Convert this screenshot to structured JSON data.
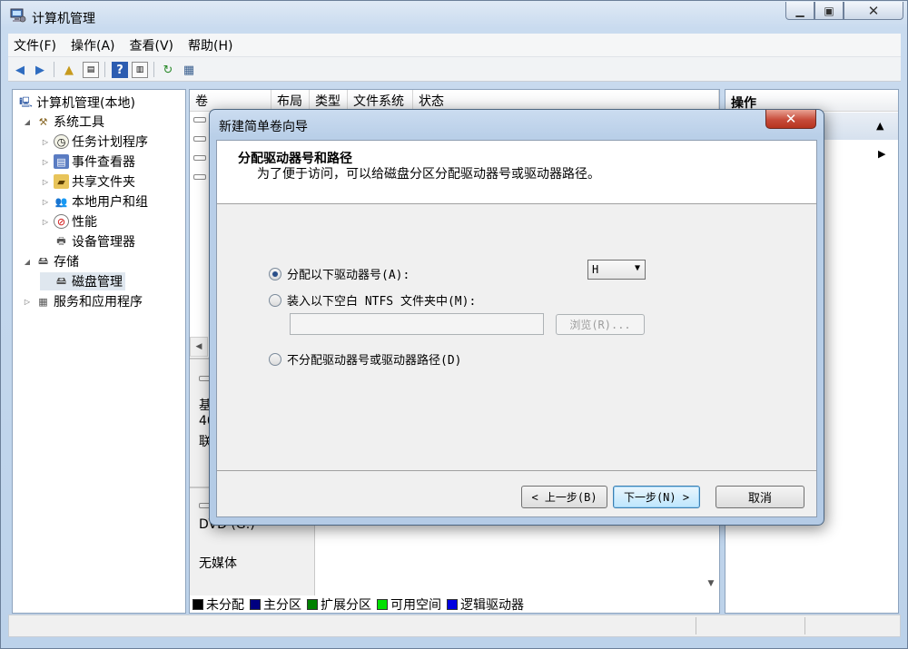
{
  "window": {
    "title": "计算机管理"
  },
  "menu": [
    "文件(F)",
    "操作(A)",
    "查看(V)",
    "帮助(H)"
  ],
  "tree": {
    "root": "计算机管理(本地)",
    "system_tools": "系统工具",
    "task_scheduler": "任务计划程序",
    "event_viewer": "事件查看器",
    "shared_folders": "共享文件夹",
    "local_users": "本地用户和组",
    "performance": "性能",
    "device_manager": "设备管理器",
    "storage": "存储",
    "disk_management": "磁盘管理",
    "services_apps": "服务和应用程序"
  },
  "columns": [
    "卷",
    "布局",
    "类型",
    "文件系统",
    "状态"
  ],
  "disk_panel": {
    "basic_label": "基",
    "size_label": "40",
    "online_label": "联",
    "dvd_label": "DVD (G:)",
    "no_media": "无媒体"
  },
  "actions": {
    "header": "操作"
  },
  "legend": [
    {
      "label": "未分配",
      "color": "#000000"
    },
    {
      "label": "主分区",
      "color": "#000080"
    },
    {
      "label": "扩展分区",
      "color": "#008000"
    },
    {
      "label": "可用空间",
      "color": "#00e000"
    },
    {
      "label": "逻辑驱动器",
      "color": "#0000e0"
    }
  ],
  "dialog": {
    "title": "新建简单卷向导",
    "header_title": "分配驱动器号和路径",
    "header_subtitle": "为了便于访问，可以给磁盘分区分配驱动器号或驱动器路径。",
    "option_assign": "分配以下驱动器号(A):",
    "option_mount": "装入以下空白 NTFS 文件夹中(M):",
    "option_none": "不分配驱动器号或驱动器路径(D)",
    "drive_letter": "H",
    "browse_label": "浏览(R)...",
    "back_label": "< 上一步(B)",
    "next_label": "下一步(N) >",
    "cancel_label": "取消"
  }
}
